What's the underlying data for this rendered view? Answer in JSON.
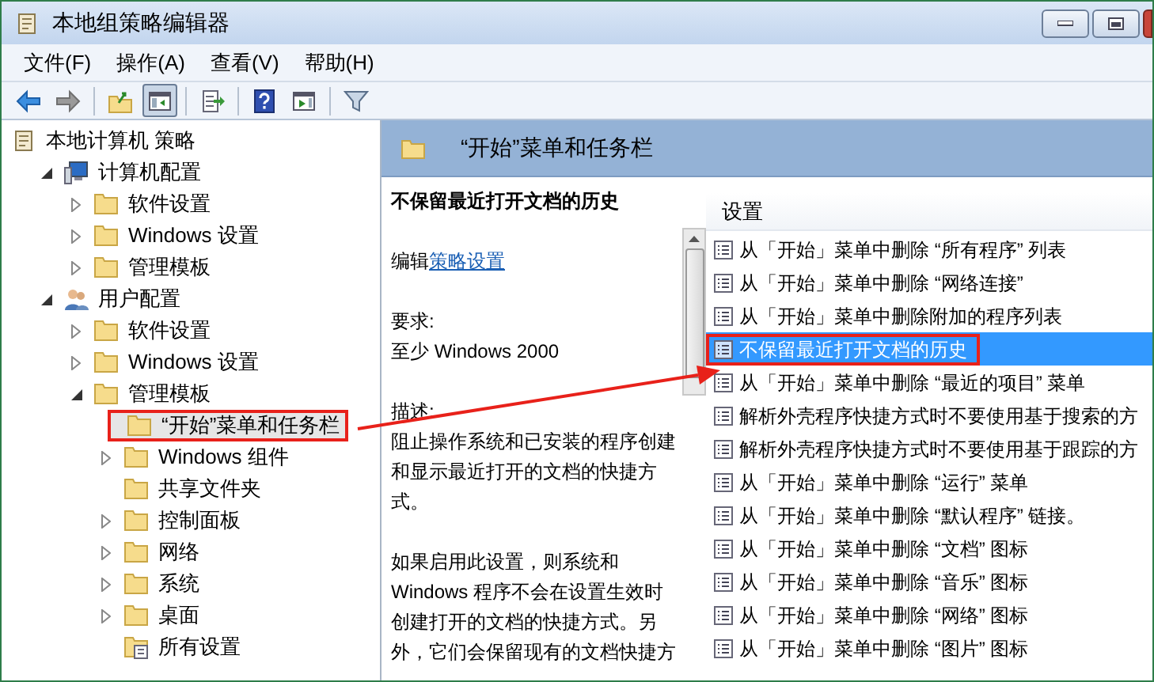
{
  "window": {
    "title": "本地组策略编辑器"
  },
  "menu": [
    "文件(F)",
    "操作(A)",
    "查看(V)",
    "帮助(H)"
  ],
  "toolbar": [
    {
      "kind": "back",
      "pressed": false
    },
    {
      "kind": "forward",
      "pressed": false
    },
    {
      "kind": "sep"
    },
    {
      "kind": "up",
      "pressed": false
    },
    {
      "kind": "tree",
      "pressed": true
    },
    {
      "kind": "sep"
    },
    {
      "kind": "export",
      "pressed": false
    },
    {
      "kind": "sep"
    },
    {
      "kind": "help",
      "pressed": false
    },
    {
      "kind": "pane",
      "pressed": false
    },
    {
      "kind": "sep"
    },
    {
      "kind": "filter",
      "pressed": false
    }
  ],
  "tree": [
    {
      "label": "本地计算机 策略",
      "kind": "policy",
      "selected": false,
      "highlighted": false,
      "children": [
        {
          "label": "计算机配置",
          "kind": "computer",
          "expanded": true,
          "selected": false,
          "highlighted": false,
          "children": [
            {
              "label": "软件设置",
              "kind": "folder",
              "expanded": false,
              "selected": false,
              "highlighted": false
            },
            {
              "label": "Windows 设置",
              "kind": "folder",
              "expanded": false,
              "selected": false,
              "highlighted": false
            },
            {
              "label": "管理模板",
              "kind": "folder",
              "expanded": false,
              "selected": false,
              "highlighted": false
            }
          ]
        },
        {
          "label": "用户配置",
          "kind": "users",
          "expanded": true,
          "selected": false,
          "highlighted": false,
          "children": [
            {
              "label": "软件设置",
              "kind": "folder",
              "expanded": false,
              "selected": false,
              "highlighted": false
            },
            {
              "label": "Windows 设置",
              "kind": "folder",
              "expanded": false,
              "selected": false,
              "highlighted": false
            },
            {
              "label": "管理模板",
              "kind": "folder",
              "expanded": true,
              "selected": false,
              "highlighted": false,
              "children": [
                {
                  "label": "“开始”菜单和任务栏",
                  "kind": "folder",
                  "selected": true,
                  "highlighted": true
                },
                {
                  "label": "Windows 组件",
                  "kind": "folder",
                  "expanded": false,
                  "selected": false,
                  "highlighted": false
                },
                {
                  "label": "共享文件夹",
                  "kind": "folder",
                  "selected": false,
                  "highlighted": false
                },
                {
                  "label": "控制面板",
                  "kind": "folder",
                  "expanded": false,
                  "selected": false,
                  "highlighted": false
                },
                {
                  "label": "网络",
                  "kind": "folder",
                  "expanded": false,
                  "selected": false,
                  "highlighted": false
                },
                {
                  "label": "系统",
                  "kind": "folder",
                  "expanded": false,
                  "selected": false,
                  "highlighted": false
                },
                {
                  "label": "桌面",
                  "kind": "folder",
                  "expanded": false,
                  "selected": false,
                  "highlighted": false
                },
                {
                  "label": "所有设置",
                  "kind": "all",
                  "selected": false,
                  "highlighted": false
                }
              ]
            }
          ]
        }
      ]
    }
  ],
  "header": {
    "title": "“开始”菜单和任务栏"
  },
  "description": {
    "title": "不保留最近打开文档的历史",
    "edit_prefix": "编辑",
    "edit_link": "策略设置",
    "requirements_label": "要求:",
    "requirements": "至少 Windows 2000",
    "description_label": "描述:",
    "paragraphs": [
      "阻止操作系统和已安装的程序创建和显示最近打开的文档的快捷方式。",
      "如果启用此设置，则系统和 Windows 程序不会在设置生效时创建打开的文档的快捷方式。另外，它们会保留现有的文档快捷方"
    ]
  },
  "list": {
    "column": "设置",
    "rows": [
      {
        "label": "从「开始」菜单中删除 “所有程序” 列表",
        "selected": false,
        "highlighted": false
      },
      {
        "label": "从「开始」菜单中删除 “网络连接”",
        "selected": false,
        "highlighted": false
      },
      {
        "label": "从「开始」菜单中删除附加的程序列表",
        "selected": false,
        "highlighted": false
      },
      {
        "label": "不保留最近打开文档的历史",
        "selected": true,
        "highlighted": true
      },
      {
        "label": "从「开始」菜单中删除 “最近的项目” 菜单",
        "selected": false,
        "highlighted": false
      },
      {
        "label": "解析外壳程序快捷方式时不要使用基于搜索的方",
        "selected": false,
        "highlighted": false
      },
      {
        "label": "解析外壳程序快捷方式时不要使用基于跟踪的方",
        "selected": false,
        "highlighted": false
      },
      {
        "label": "从「开始」菜单中删除 “运行” 菜单",
        "selected": false,
        "highlighted": false
      },
      {
        "label": "从「开始」菜单中删除 “默认程序” 链接。",
        "selected": false,
        "highlighted": false
      },
      {
        "label": "从「开始」菜单中删除 “文档” 图标",
        "selected": false,
        "highlighted": false
      },
      {
        "label": "从「开始」菜单中删除 “音乐” 图标",
        "selected": false,
        "highlighted": false
      },
      {
        "label": "从「开始」菜单中删除 “网络” 图标",
        "selected": false,
        "highlighted": false
      },
      {
        "label": "从「开始」菜单中删除 “图片” 图标",
        "selected": false,
        "highlighted": false
      }
    ]
  }
}
